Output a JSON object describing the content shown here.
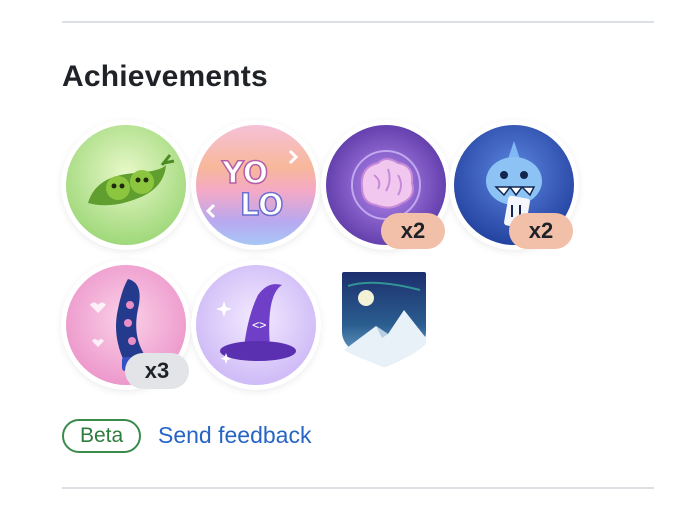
{
  "section": {
    "title": "Achievements"
  },
  "badges": [
    {
      "name": "pea-pod",
      "count": ""
    },
    {
      "name": "yolo",
      "count": "",
      "text": "YO LO"
    },
    {
      "name": "galaxy-brain",
      "count": "x2"
    },
    {
      "name": "pull-shark",
      "count": "x2"
    },
    {
      "name": "starstruck-tentacle",
      "count": "x3"
    },
    {
      "name": "wizard-hat",
      "count": ""
    },
    {
      "name": "arctic-code-vault",
      "count": ""
    }
  ],
  "footer": {
    "beta_label": "Beta",
    "feedback_label": "Send feedback"
  },
  "colors": {
    "count_peach": "#f2c0a8",
    "count_grey": "#e2e4e8",
    "beta_green": "#2f7d3e",
    "link_blue": "#2665c6"
  }
}
